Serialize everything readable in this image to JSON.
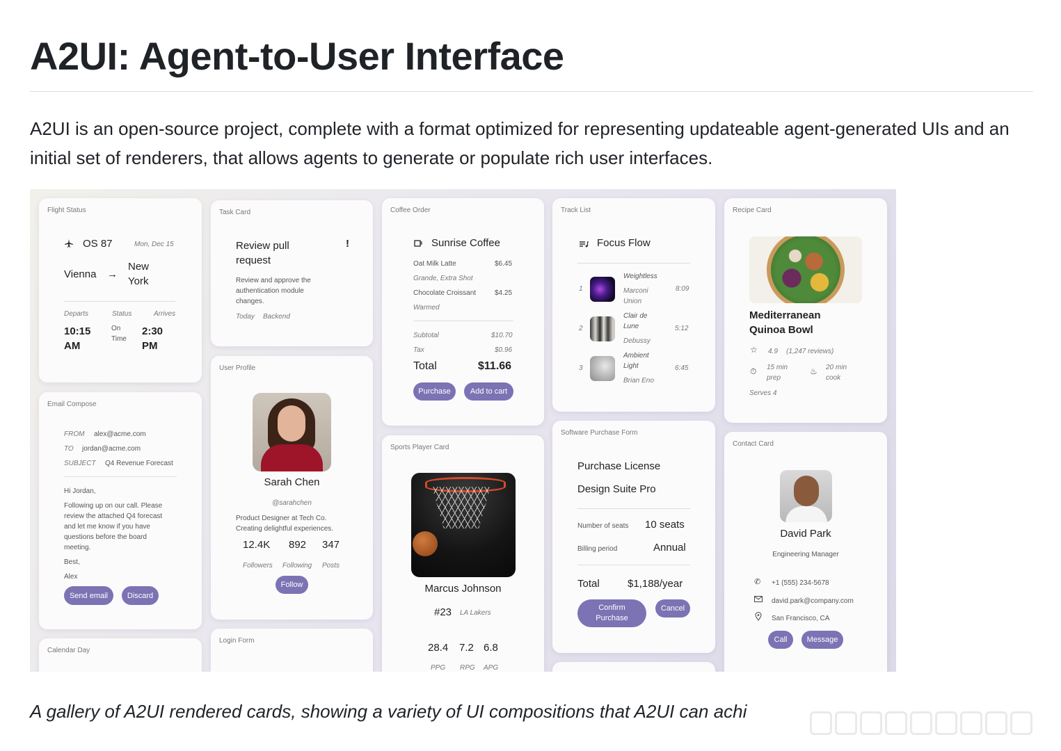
{
  "title": "A2UI: Agent-to-User Interface",
  "intro": "A2UI is an open-source project, complete with a format optimized for representing updateable agent-generated UIs and an initial set of renderers, that allows agents to generate or populate rich user interfaces.",
  "caption": "A gallery of A2UI rendered cards, showing a variety of UI compositions that A2UI can achi",
  "accent_color": "#7b73b3",
  "flight": {
    "label": "Flight Status",
    "flight_no": "OS 87",
    "date": "Mon, Dec 15",
    "from": "Vienna",
    "arrow": "→",
    "to_line1": "New",
    "to_line2": "York",
    "departs_label": "Departs",
    "status_label": "Status",
    "arrives_label": "Arrives",
    "dep_time": "10:15",
    "dep_ampm": "AM",
    "status1": "On",
    "status2": "Time",
    "arr_time": "2:30",
    "arr_ampm": "PM"
  },
  "task": {
    "label": "Task Card",
    "title1": "Review pull",
    "title2": "request",
    "flag": "!",
    "desc1": "Review and approve the",
    "desc2": "authentication module",
    "desc3": "changes.",
    "due": "Today",
    "tag": "Backend"
  },
  "coffee": {
    "label": "Coffee Order",
    "shop": "Sunrise Coffee",
    "item1": "Oat Milk Latte",
    "price1": "$6.45",
    "item1_opt": "Grande, Extra Shot",
    "item2": "Chocolate Croissant",
    "price2": "$4.25",
    "item2_opt": "Warmed",
    "subtotal_label": "Subtotal",
    "subtotal": "$10.70",
    "tax_label": "Tax",
    "tax": "$0.96",
    "total_label": "Total",
    "total": "$11.66",
    "purchase": "Purchase",
    "add_to_cart": "Add to cart"
  },
  "tracks": {
    "label": "Track List",
    "playlist": "Focus Flow",
    "items": [
      {
        "num": "1",
        "title1": "Weightless",
        "artist1": "Marconi",
        "artist2": "Union",
        "time": "8:09"
      },
      {
        "num": "2",
        "title1": "Clair de",
        "title2": "Lune",
        "artist1": "Debussy",
        "time": "5:12"
      },
      {
        "num": "3",
        "title1": "Ambient",
        "title2": "Light",
        "artist1": "Brian Eno",
        "time": "6:45"
      }
    ]
  },
  "recipe": {
    "label": "Recipe Card",
    "title1": "Mediterranean",
    "title2": "Quinoa Bowl",
    "rating": "4.9",
    "reviews": "(1,247 reviews)",
    "prep1": "15 min",
    "prep2": "prep",
    "cook1": "20 min",
    "cook2": "cook",
    "serves": "Serves 4"
  },
  "email": {
    "label": "Email Compose",
    "from_label": "FROM",
    "from": "alex@acme.com",
    "to_label": "TO",
    "to": "jordan@acme.com",
    "subject_label": "SUBJECT",
    "subject": "Q4 Revenue Forecast",
    "greeting": "Hi Jordan,",
    "body1": "Following up on our call. Please",
    "body2": "review the attached Q4 forecast",
    "body3": "and let me know if you have",
    "body4": "questions before the board",
    "body5": "meeting.",
    "signoff": "Best,",
    "signature": "Alex",
    "send": "Send email",
    "discard": "Discard"
  },
  "profile": {
    "label": "User Profile",
    "name": "Sarah Chen",
    "handle": "@sarahchen",
    "bio1": "Product Designer at Tech Co.",
    "bio2": "Creating delightful experiences.",
    "followers": "12.4K",
    "following": "892",
    "posts": "347",
    "followers_label": "Followers",
    "following_label": "Following",
    "posts_label": "Posts",
    "follow": "Follow"
  },
  "player": {
    "label": "Sports Player Card",
    "name": "Marcus Johnson",
    "number": "#23",
    "team": "LA Lakers",
    "ppg": "28.4",
    "rpg": "7.2",
    "apg": "6.8",
    "ppg_label": "PPG",
    "rpg_label": "RPG",
    "apg_label": "APG"
  },
  "purchase": {
    "label": "Software Purchase Form",
    "title": "Purchase License",
    "product": "Design Suite Pro",
    "seats_label": "Number of seats",
    "seats": "10 seats",
    "billing_label": "Billing period",
    "billing": "Annual",
    "total_label": "Total",
    "total": "$1,188/year",
    "confirm1": "Confirm",
    "confirm2": "Purchase",
    "cancel": "Cancel"
  },
  "contact": {
    "label": "Contact Card",
    "name": "David Park",
    "role": "Engineering Manager",
    "phone": "+1 (555) 234-5678",
    "email": "david.park@company.com",
    "location": "San Francisco, CA",
    "call": "Call",
    "message": "Message"
  },
  "calendar": {
    "label": "Calendar Day"
  },
  "login": {
    "label": "Login Form"
  }
}
